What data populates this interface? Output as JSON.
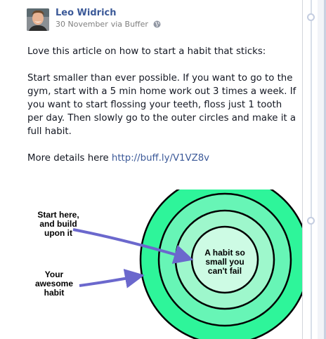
{
  "post": {
    "author": "Leo Widrich",
    "date": "30 November",
    "via": "via Buffer",
    "paragraphs": [
      "Love this article on how to start a habit that sticks:",
      "Start smaller than ever possible. If you want to go to the gym, start with a 5 min home work out 3 times a week. If you want to start flossing your teeth, floss just 1 tooth per day. Then slowly go to the outer circles and make it a full habit."
    ],
    "more_prefix": "More details here ",
    "link_text": "http://buff.ly/V1VZ8v"
  },
  "diagram": {
    "label_start_l1": "Start here,",
    "label_start_l2": "and build",
    "label_start_l3": "upon it",
    "label_awesome_l1": "Your",
    "label_awesome_l2": "awesome",
    "label_awesome_l3": "habit",
    "center_l1": "A habit so",
    "center_l2": "small you",
    "center_l3": "can't fail"
  },
  "colors": {
    "link": "#3b5998",
    "ring_outer": "#2ef59a",
    "ring_2": "#67f5b6",
    "ring_3": "#9ef7cc",
    "ring_center": "#cdfbe4",
    "arrow": "#6b68cd"
  },
  "icons": {
    "privacy": "globe-icon"
  }
}
